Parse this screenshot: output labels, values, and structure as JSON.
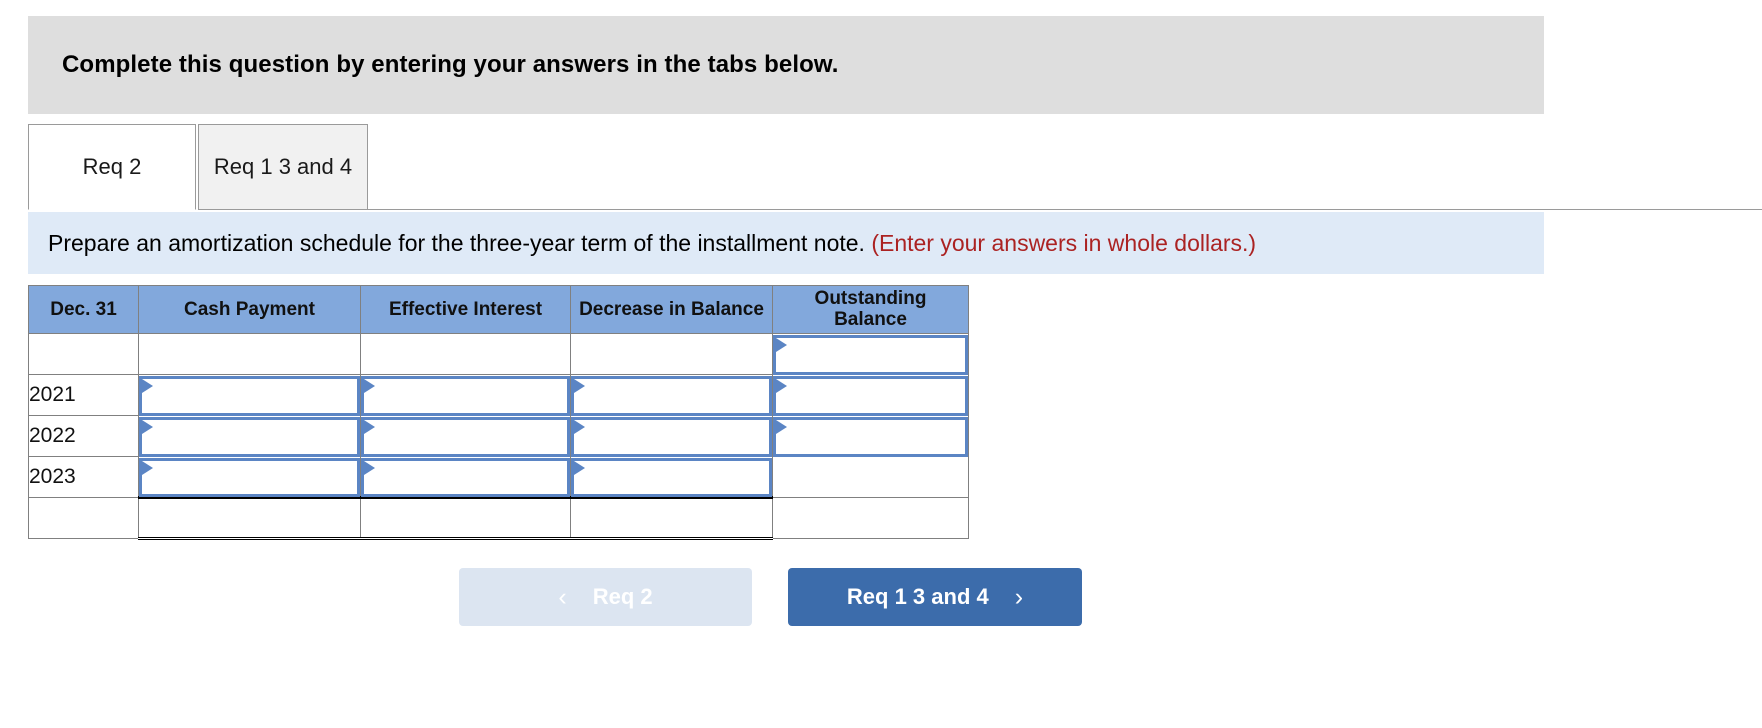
{
  "banner": {
    "text": "Complete this question by entering your answers in the tabs below."
  },
  "tabs": [
    {
      "label": "Req 2",
      "active": true
    },
    {
      "label": "Req 1 3 and 4",
      "active": false
    }
  ],
  "requirement": {
    "text": "Prepare an amortization schedule for the three-year term of the installment note.",
    "note": "(Enter your answers in whole dollars.)"
  },
  "table": {
    "columns": [
      "Dec. 31",
      "Cash Payment",
      "Effective Interest",
      "Decrease in Balance",
      "Outstanding Balance"
    ],
    "rows": [
      {
        "date": "",
        "cash": "",
        "effective": "",
        "decrease": "",
        "outstanding": ""
      },
      {
        "date": "2021",
        "cash": "",
        "effective": "",
        "decrease": "",
        "outstanding": ""
      },
      {
        "date": "2022",
        "cash": "",
        "effective": "",
        "decrease": "",
        "outstanding": ""
      },
      {
        "date": "2023",
        "cash": "",
        "effective": "",
        "decrease": "",
        "outstanding": ""
      },
      {
        "date": "",
        "cash": "",
        "effective": "",
        "decrease": "",
        "outstanding": ""
      }
    ]
  },
  "nav": {
    "prev_label": "Req 2",
    "prev_chevron": "‹",
    "next_label": "Req 1 3 and 4",
    "next_chevron": "›"
  },
  "colors": {
    "banner_bg": "#dedede",
    "reqbar_bg": "#dfeaf7",
    "note_red": "#ab2222",
    "header_blue": "#82a8dc",
    "input_border": "#5b85c4",
    "btn_next_bg": "#3c6cab",
    "btn_prev_bg": "#dce5f1"
  }
}
